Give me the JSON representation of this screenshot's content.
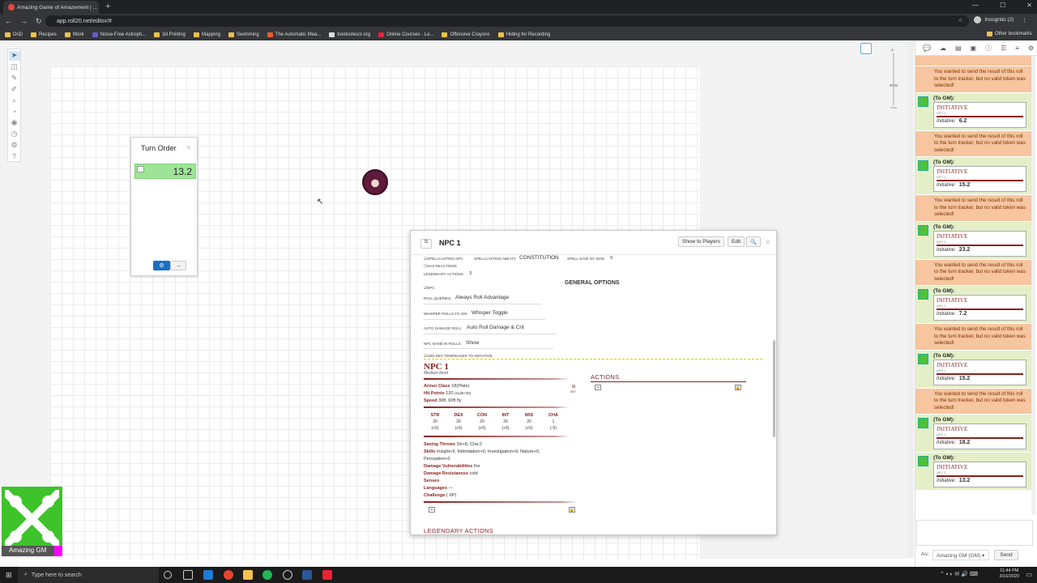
{
  "browser": {
    "tab_title": "Amazing Game of Amazement | ...",
    "url": "app.roll20.net/editor/#",
    "profile": "Incognito (2)",
    "bookmarks": [
      "DnD",
      "Recipes",
      "Work",
      "Noise-Free Astroph...",
      "3d Printing",
      "Mapping",
      "Swimming",
      "The Automatic Mea...",
      "booksdescr.org",
      "Online Courses - Le...",
      "Offensive Crayons",
      "Hiding for Recording"
    ],
    "other_bookmarks": "Other bookmarks"
  },
  "turn_order": {
    "title": "Turn Order",
    "entry_value": "13.2"
  },
  "npc": {
    "title": "NPC 1",
    "buttons": {
      "show": "Show to Players",
      "edit": "Edit",
      "search": "🔍"
    },
    "spellcasting_npc": "SPELLCASTING NPC",
    "spell_ability_label": "SPELLCASTING ABILITY",
    "spell_ability": "CONSTITUTION",
    "spell_dc_label": "SPELL SAVE DC MOD",
    "spell_dc": "0",
    "has_reactions": "HAS REACTIONS",
    "legendary_label": "LEGENDARY ACTIONS:",
    "legendary_value": "3",
    "general_options": "GENERAL OPTIONS",
    "npc_check": "NPC",
    "roll_queries_label": "ROLL QUERIES:",
    "roll_queries": "Always Roll Advantage",
    "whisper_label": "WHISPER ROLLS TO GM:",
    "whisper": "Whisper Toggle",
    "auto_damage_label": "AUTO DAMAGE ROLL:",
    "auto_damage": "Auto Roll Damage & Crit",
    "name_in_rolls_label": "NPC NAME IN ROLLS:",
    "name_in_rolls": "Show",
    "tiebreaker": "ADD DEX TIEBREAKER TO INITIATIVE",
    "sb_name": "NPC 1",
    "sb_type": "Medium fiend",
    "armor_label": "Armor Class",
    "armor": "18(Plate)",
    "hp_label": "Hit Points",
    "hp": "120",
    "hp_formula": "(11d8+33)",
    "speed_label": "Speed",
    "speed": "30ft, 60ft fly",
    "abilities": [
      {
        "name": "STR",
        "score": "20",
        "mod": "(+5)"
      },
      {
        "name": "DEX",
        "score": "20",
        "mod": "(+5)"
      },
      {
        "name": "CON",
        "score": "20",
        "mod": "(+5)"
      },
      {
        "name": "INT",
        "score": "20",
        "mod": "(+5)"
      },
      {
        "name": "WIS",
        "score": "20",
        "mod": "(+5)"
      },
      {
        "name": "CHA",
        "score": "1",
        "mod": "(-5)"
      }
    ],
    "saves_label": "Saving Throws",
    "saves": "Str+8, Cha-2",
    "skills_label": "Skills",
    "skills": "Insight+9, Intimidation+0, Investigation+9, Nature+0,",
    "skills2": "Perception+0",
    "vuln_label": "Damage Vulnerabilities",
    "vuln": "fire",
    "resist_label": "Damage Resistances",
    "resist": "cold",
    "senses_label": "Senses",
    "languages_label": "Languages",
    "languages": "—",
    "challenge_label": "Challenge",
    "challenge": "( XP)",
    "actions_title": "ACTIONS",
    "legendary_title": "LEGENDARY ACTIONS",
    "init_label": "INIT"
  },
  "chat": {
    "system_msg": "You wanted to send the result of this roll to the turn tracker, but no valid token was selected!",
    "to_gm": "(To GM):",
    "card_title": "INITIATIVE",
    "card_sub": "NPC 1",
    "init_label": "Initiative",
    "rolls": [
      "6.2",
      "15.2",
      "23.2",
      "7.2",
      "15.2",
      "18.2",
      "13.2"
    ],
    "as_label": "As:",
    "as_value": "Amazing GM (GM)",
    "send": "Send"
  },
  "player": {
    "name": "Amazing GM",
    "color": "#ff00ff"
  },
  "taskbar": {
    "search": "Type here to search",
    "time": "11:44 PM",
    "date": "3/16/2020"
  }
}
